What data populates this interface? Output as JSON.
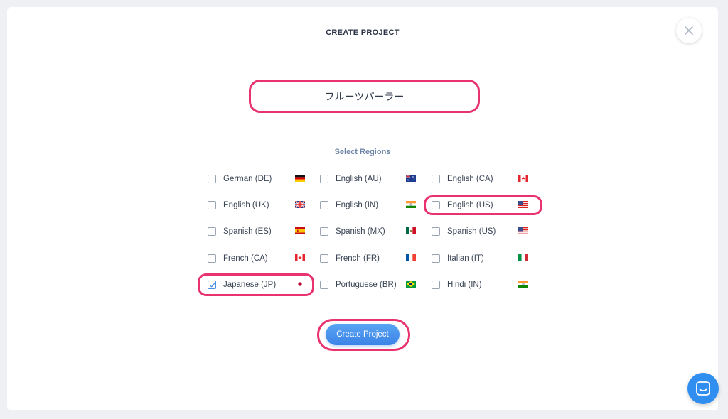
{
  "modal": {
    "title": "CREATE PROJECT",
    "project_name": "フルーツパーラー",
    "select_regions_label": "Select Regions",
    "create_button_label": "Create Project"
  },
  "regions": [
    {
      "id": "de-DE",
      "label": "German (DE)",
      "checked": false,
      "flag": "de-flag-icon"
    },
    {
      "id": "en-AU",
      "label": "English (AU)",
      "checked": false,
      "flag": "au-flag-icon"
    },
    {
      "id": "en-CA",
      "label": "English (CA)",
      "checked": false,
      "flag": "ca-flag-icon"
    },
    {
      "id": "en-UK",
      "label": "English (UK)",
      "checked": false,
      "flag": "uk-flag-icon"
    },
    {
      "id": "en-IN",
      "label": "English (IN)",
      "checked": false,
      "flag": "in-flag-icon"
    },
    {
      "id": "en-US",
      "label": "English (US)",
      "checked": false,
      "flag": "us-flag-icon"
    },
    {
      "id": "es-ES",
      "label": "Spanish (ES)",
      "checked": false,
      "flag": "es-flag-icon"
    },
    {
      "id": "es-MX",
      "label": "Spanish (MX)",
      "checked": false,
      "flag": "mx-flag-icon"
    },
    {
      "id": "es-US",
      "label": "Spanish (US)",
      "checked": false,
      "flag": "us-flag-icon"
    },
    {
      "id": "fr-CA",
      "label": "French (CA)",
      "checked": false,
      "flag": "ca-flag-icon"
    },
    {
      "id": "fr-FR",
      "label": "French (FR)",
      "checked": false,
      "flag": "fr-flag-icon"
    },
    {
      "id": "it-IT",
      "label": "Italian (IT)",
      "checked": false,
      "flag": "it-flag-icon"
    },
    {
      "id": "ja-JP",
      "label": "Japanese (JP)",
      "checked": true,
      "flag": "jp-flag-icon"
    },
    {
      "id": "pt-BR",
      "label": "Portuguese (BR)",
      "checked": false,
      "flag": "br-flag-icon"
    },
    {
      "id": "hi-IN",
      "label": "Hindi (IN)",
      "checked": false,
      "flag": "in-flag-icon"
    }
  ],
  "colors": {
    "highlight": "#e8336f",
    "accent": "#3b83e6",
    "label_muted": "#6f86a8"
  },
  "icons": {
    "close": "close-icon",
    "chat": "chat-icon"
  }
}
